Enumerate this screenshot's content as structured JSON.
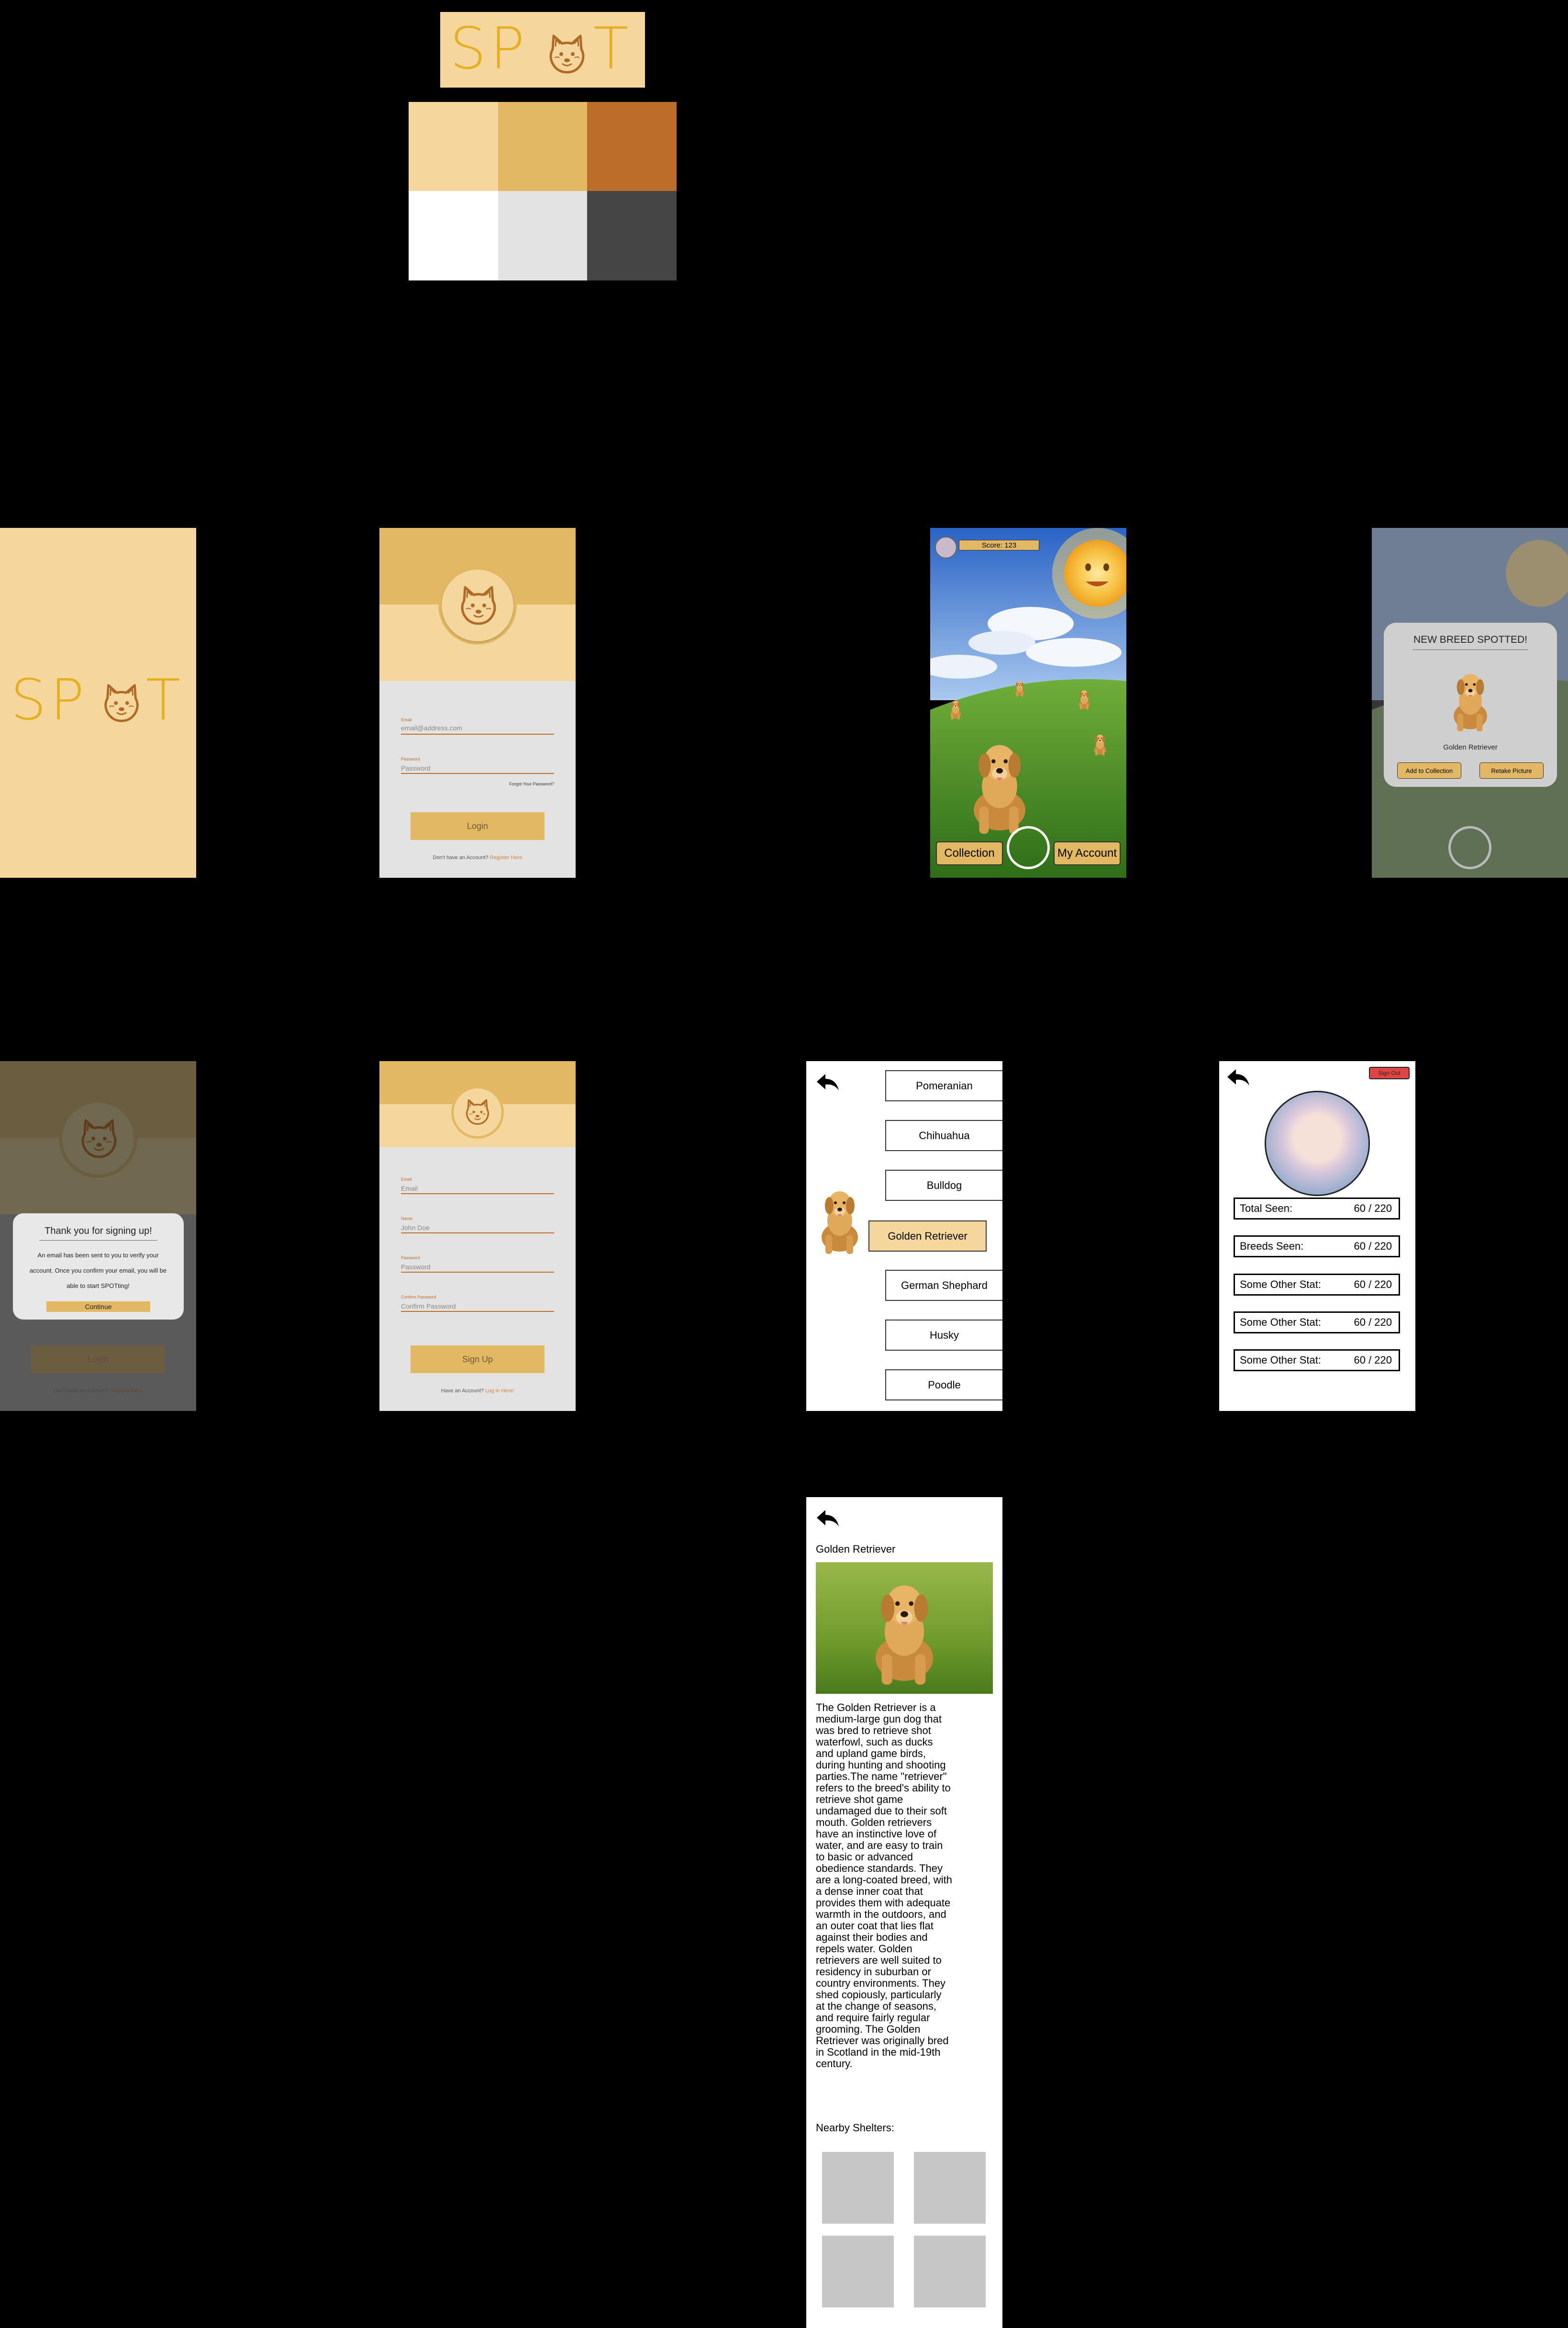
{
  "logo": {
    "text_left": "SP",
    "text_right": "T"
  },
  "palette": {
    "colors": [
      "#f5d79e",
      "#e3b863",
      "#bd6d2a",
      "#ffffff",
      "#e3e3e3",
      "#454545"
    ]
  },
  "splash": {
    "text_left": "SP",
    "text_right": "T"
  },
  "login": {
    "email_label": "Email",
    "email_value": "email@address.com",
    "password_label": "Password",
    "password_placeholder": "Password",
    "forgot_link": "Forgot Your Password?",
    "login_button": "Login",
    "register_prompt": "Don't have an Account?",
    "register_link": "Register Here"
  },
  "camera": {
    "score_label": "Score: 123",
    "collection_button": "Collection",
    "account_button": "My Account"
  },
  "spotted_popup": {
    "title": "NEW BREED SPOTTED!",
    "breed_name": "Golden Retriever",
    "add_button": "Add to Collection",
    "retake_button": "Retake Picture"
  },
  "signup_modal": {
    "title": "Thank you for signing up!",
    "message": "An email has been sent to you to verify your account. Once you confirm your email, you will be able to start SPOTting!",
    "continue_button": "Continue",
    "bg_login_button": "Login",
    "bg_register_prompt": "Don't have an Account?",
    "bg_register_link": "Register Here"
  },
  "signup": {
    "email_label": "Email",
    "email_placeholder": "Email",
    "name_label": "Name",
    "name_placeholder": "John Doe",
    "password_label": "Password",
    "password_placeholder": "Password",
    "confirm_label": "Confirm Password",
    "confirm_placeholder": "Confirm Password",
    "signup_button": "Sign Up",
    "login_prompt": "Have an Account?",
    "login_link": "Log in Here!"
  },
  "collection": {
    "breeds": [
      "Pomeranian",
      "Chihuahua",
      "Bulldog",
      "Golden Retriever",
      "German Shephard",
      "Husky",
      "Poodle"
    ],
    "selected_index": 3
  },
  "account": {
    "signout_button": "Sign Out",
    "stats": [
      {
        "label": "Total Seen:",
        "value": "60 / 220"
      },
      {
        "label": "Breeds Seen:",
        "value": "60 / 220"
      },
      {
        "label": "Some Other Stat:",
        "value": "60 / 220"
      },
      {
        "label": "Some Other Stat:",
        "value": "60 / 220"
      },
      {
        "label": "Some Other Stat:",
        "value": "60 / 220"
      }
    ]
  },
  "breed_detail": {
    "title": "Golden Retriever",
    "description": "The Golden Retriever is a medium-large gun dog that was bred to retrieve shot waterfowl, such as ducks and upland game birds, during hunting and shooting parties.The name \"retriever\" refers to the breed's ability to retrieve shot game undamaged due to their soft mouth. Golden retrievers have an instinctive love of water, and are easy to train to basic or advanced obedience standards. They are a long-coated breed, with a dense inner coat that provides them with adequate warmth in the outdoors, and an outer coat that lies flat against their bodies and repels water. Golden retrievers are well suited to residency in suburban or country environments. They shed copiously, particularly at the change of seasons, and require fairly regular grooming. The Golden Retriever was originally bred in Scotland in the mid-19th century.",
    "shelters_heading": "Nearby Shelters:"
  }
}
